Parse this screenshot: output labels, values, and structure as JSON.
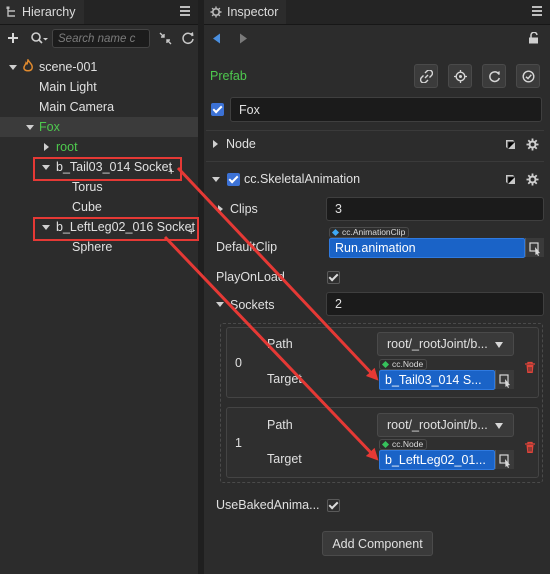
{
  "hierarchy": {
    "tab_title": "Hierarchy",
    "search_placeholder": "Search name c",
    "nodes": [
      {
        "label": "scene-001"
      },
      {
        "label": "Main Light"
      },
      {
        "label": "Main Camera"
      },
      {
        "label": "Fox"
      },
      {
        "label": "root"
      },
      {
        "label": "b_Tail03_014 Socket"
      },
      {
        "label": "Torus"
      },
      {
        "label": "Cube"
      },
      {
        "label": "b_LeftLeg02_016 Socket"
      },
      {
        "label": "Sphere"
      }
    ]
  },
  "inspector": {
    "tab_title": "Inspector",
    "prefab_label": "Prefab",
    "node_name": "Fox",
    "node_section": "Node",
    "component_name": "cc.SkeletalAnimation",
    "clips_label": "Clips",
    "clips_value": "3",
    "default_clip_label": "DefaultClip",
    "default_clip_type": "cc.AnimationClip",
    "default_clip_value": "Run.animation",
    "play_on_load_label": "PlayOnLoad",
    "sockets_label": "Sockets",
    "sockets_value": "2",
    "sockets": [
      {
        "index": "0",
        "path_label": "Path",
        "path_value": "root/_rootJoint/b...",
        "target_label": "Target",
        "target_type": "cc.Node",
        "target_value": "b_Tail03_014 S..."
      },
      {
        "index": "1",
        "path_label": "Path",
        "path_value": "root/_rootJoint/b...",
        "target_label": "Target",
        "target_type": "cc.Node",
        "target_value": "b_LeftLeg02_01..."
      }
    ],
    "use_baked_label": "UseBakedAnima...",
    "add_component_label": "Add Component"
  },
  "colors": {
    "prefab_green": "#4ec94e",
    "selection_blue": "#1a63c7",
    "annotation_red": "#e53935",
    "fox_row": "#3b3b3b"
  }
}
